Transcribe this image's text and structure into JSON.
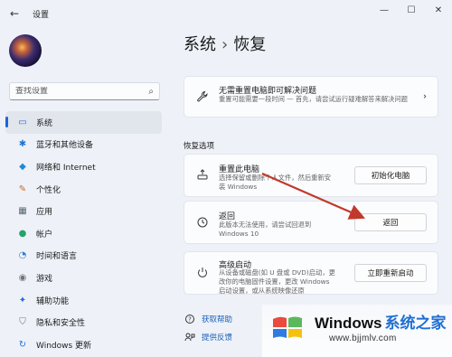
{
  "window": {
    "title": "设置",
    "back_icon": "←",
    "min_icon": "—",
    "max_icon": "☐",
    "close_icon": "✕"
  },
  "sidebar": {
    "search_placeholder": "查找设置",
    "items": [
      {
        "label": "系统",
        "icon": "monitor-icon",
        "glyph": "▭",
        "color": "#2b6cd3",
        "active": true
      },
      {
        "label": "蓝牙和其他设备",
        "icon": "bluetooth-icon",
        "glyph": "✱",
        "color": "#1e74d6"
      },
      {
        "label": "网络和 Internet",
        "icon": "wifi-icon",
        "glyph": "◆",
        "color": "#1f8ad8"
      },
      {
        "label": "个性化",
        "icon": "brush-icon",
        "glyph": "✎",
        "color": "#c56a2d"
      },
      {
        "label": "应用",
        "icon": "apps-icon",
        "glyph": "▦",
        "color": "#5a6572"
      },
      {
        "label": "帐户",
        "icon": "account-icon",
        "glyph": "●",
        "color": "#25a36b"
      },
      {
        "label": "时间和语言",
        "icon": "clock-globe-icon",
        "glyph": "◔",
        "color": "#2a7bd6"
      },
      {
        "label": "游戏",
        "icon": "gamepad-icon",
        "glyph": "◉",
        "color": "#6b7480"
      },
      {
        "label": "辅助功能",
        "icon": "accessibility-icon",
        "glyph": "✦",
        "color": "#2b6cd3"
      },
      {
        "label": "隐私和安全性",
        "icon": "shield-icon",
        "glyph": "⛉",
        "color": "#6b7480"
      },
      {
        "label": "Windows 更新",
        "icon": "update-icon",
        "glyph": "↻",
        "color": "#1e74d6"
      }
    ]
  },
  "header": {
    "breadcrumb_parent": "系统",
    "separator": "›",
    "title": "恢复"
  },
  "fix_card": {
    "title": "无需重置电脑即可解决问题",
    "desc": "重置可能需要一段时间 — 首先，请尝试运行疑难解答来解决问题",
    "icon": "wrench-icon"
  },
  "section_label": "恢复选项",
  "options": [
    {
      "title": "重置此电脑",
      "desc": "选择保留或删除个人文件，然后重新安装 Windows",
      "button": "初始化电脑",
      "icon": "reset-pc-icon"
    },
    {
      "title": "返回",
      "desc": "此版本无法使用，请尝试回退到 Windows 10",
      "button": "返回",
      "icon": "history-icon"
    },
    {
      "title": "高级启动",
      "desc": "从设备或磁盘(如 U 盘或 DVD)启动，更改你的电脑固件设置，更改 Windows 启动设置，或从系统映像还原 Windows。这将重新启动电脑。",
      "button": "立即重新启动",
      "icon": "advanced-startup-icon"
    }
  ],
  "links": [
    {
      "label": "获取帮助",
      "icon": "help-icon"
    },
    {
      "label": "提供反馈",
      "icon": "feedback-icon"
    }
  ],
  "watermark": {
    "brand": "Windows",
    "brand_cn": "系统之家",
    "url": "www.bjjmlv.com"
  },
  "colors": {
    "accent": "#1c64d6",
    "annotation_arrow": "#c0392b",
    "link": "#1d5fb8"
  }
}
